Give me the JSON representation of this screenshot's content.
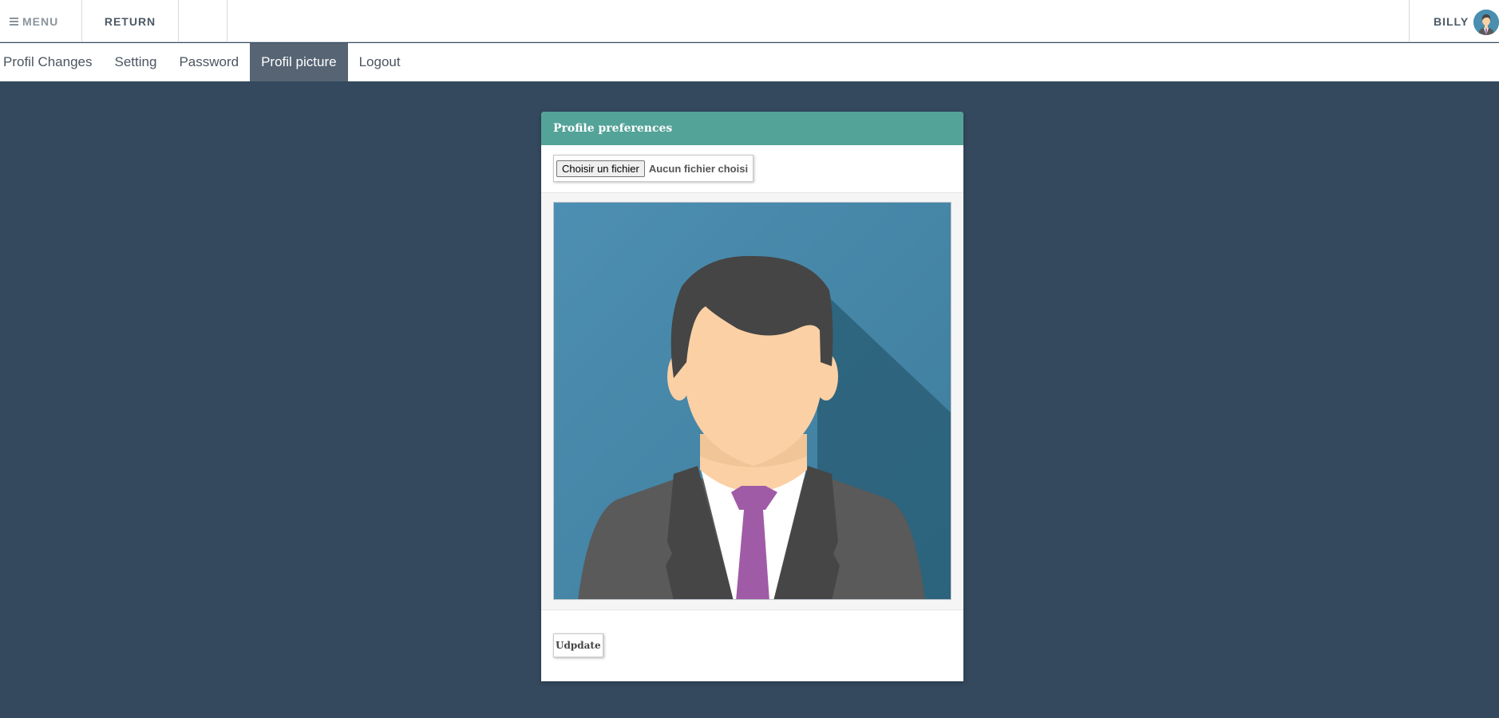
{
  "topbar": {
    "menu_label": "MENU",
    "return_label": "RETURN",
    "user_name": "BILLY"
  },
  "tabs": [
    {
      "label": "Profil Changes",
      "active": false
    },
    {
      "label": "Setting",
      "active": false
    },
    {
      "label": "Password",
      "active": false
    },
    {
      "label": "Profil picture",
      "active": true
    },
    {
      "label": "Logout",
      "active": false
    }
  ],
  "panel": {
    "title": "Profile preferences",
    "file_button_label": "Choisir un fichier",
    "file_status": "Aucun fichier choisi",
    "update_label": "Udpdate"
  },
  "colors": {
    "background": "#34495e",
    "header_accent": "#54a399",
    "active_tab": "#566474",
    "avatar_bg": "#4a8fb0",
    "tie": "#a05ba6",
    "suit": "#5a5a5a",
    "skin": "#fbd0a5",
    "hair": "#454545"
  },
  "icons": {
    "menu": "hamburger-icon",
    "avatar": "user-avatar-icon",
    "profile_picture": "businessman-avatar-image"
  }
}
